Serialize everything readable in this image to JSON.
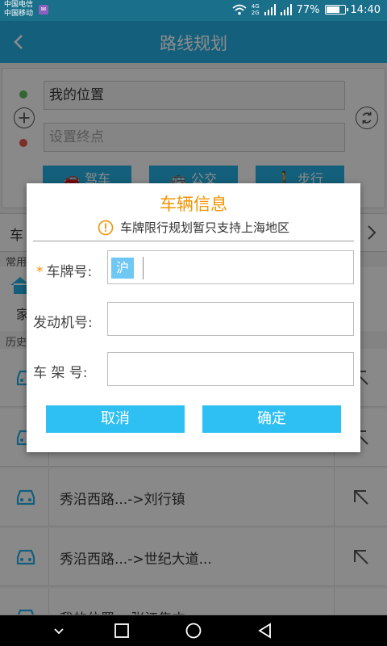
{
  "status_bar": {
    "carrier_1": "中国电信",
    "carrier_2": "中国移动",
    "network_1": "4G",
    "network_2": "2G",
    "battery_percent": "77%",
    "battery_level": 0.77,
    "time": "14:40"
  },
  "header": {
    "title": "路线规划",
    "back_icon": "chevron-left-icon"
  },
  "route": {
    "start_value": "我的位置",
    "end_placeholder": "设置终点",
    "modes": [
      {
        "label": "驾车",
        "icon": "car-icon"
      },
      {
        "label": "公交",
        "icon": "bus-icon"
      },
      {
        "label": "步行",
        "icon": "walk-icon"
      }
    ]
  },
  "background": {
    "car_row_label": "车",
    "common_label": "常用",
    "home_label": "家",
    "history_label": "历史",
    "history": [
      {
        "text": ""
      },
      {
        "text": ""
      },
      {
        "text": "秀沿西路...->刘行镇"
      },
      {
        "text": "秀沿西路...->世纪大道..."
      },
      {
        "text": "我的位置->张江集中"
      }
    ]
  },
  "dialog": {
    "title": "车辆信息",
    "notice": "车牌限行规划暂只支持上海地区",
    "plate_label": "车牌号:",
    "plate_required": "*",
    "plate_prefix": "沪",
    "plate_value": "",
    "engine_label": "发动机号:",
    "engine_value": "",
    "frame_label": "车 架 号:",
    "frame_value": "",
    "cancel_label": "取消",
    "confirm_label": "确定",
    "colors": {
      "title": "#f29300",
      "button": "#2ec0f2",
      "accent": "#26aee0"
    }
  }
}
